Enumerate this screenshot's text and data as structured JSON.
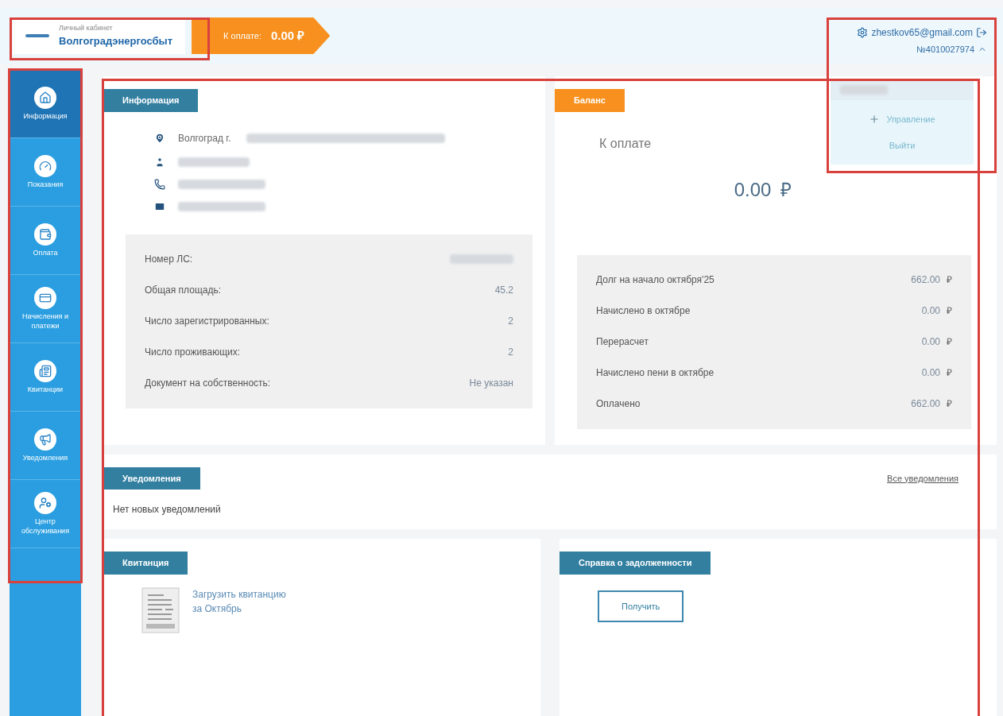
{
  "header": {
    "logo_caption": "Личный кабинет",
    "logo_title": "Волгоградэнергосбыт",
    "due_label": "К оплате:",
    "due_amount": "0.00 ₽"
  },
  "account": {
    "email": "zhestkov65@gmail.com",
    "number": "№4010027974",
    "expanded": true
  },
  "account_menu": {
    "items": [
      {
        "kind": "add",
        "label": "Управление"
      },
      {
        "kind": "plain",
        "label": "Выйти"
      }
    ]
  },
  "sidebar": {
    "items": [
      {
        "label": "Информация",
        "selected": true
      },
      {
        "label": "Показания",
        "selected": false
      },
      {
        "label": "Оплата",
        "selected": false
      },
      {
        "label": "Начисления и платежи",
        "selected": false
      },
      {
        "label": "Квитанции",
        "selected": false
      },
      {
        "label": "Уведомления",
        "selected": false
      },
      {
        "label": "Центр обслуживания",
        "selected": false
      }
    ]
  },
  "info": {
    "title": "Информация",
    "address_visible": "Волгоград г. ",
    "rows": [
      {
        "label": "Номер ЛС:"
      },
      {
        "label": "Общая площадь:",
        "value": "45.2"
      },
      {
        "label": "Число зарегистрированных:",
        "value": "2"
      },
      {
        "label": "Число проживающих:",
        "value": "2"
      },
      {
        "label": "Документ на собственность:",
        "value": "Не указан"
      }
    ]
  },
  "balance": {
    "title": "Баланс",
    "caption": "К оплате",
    "amount": "0.00",
    "currency": "₽",
    "rows": [
      {
        "label": "Долг на начало октября'25",
        "value": "662.00",
        "currency": "₽"
      },
      {
        "label": "Начислено в октябре",
        "value": "0.00",
        "currency": "₽"
      },
      {
        "label": "Перерасчет",
        "value": "0.00",
        "currency": "₽"
      },
      {
        "label": "Начислено пени в октябре",
        "value": "0.00",
        "currency": "₽"
      },
      {
        "label": "Оплачено",
        "value": "662.00",
        "currency": "₽"
      }
    ]
  },
  "notifications": {
    "title": "Уведомления",
    "all_link": "Все уведомления",
    "empty": "Нет новых уведомлений"
  },
  "receipt": {
    "title": "Квитанция",
    "link_line1": "Загрузить квитанцию",
    "link_line2": "за Октябрь"
  },
  "debt_certificate": {
    "title": "Справка о задолженности",
    "button": "Получить"
  }
}
